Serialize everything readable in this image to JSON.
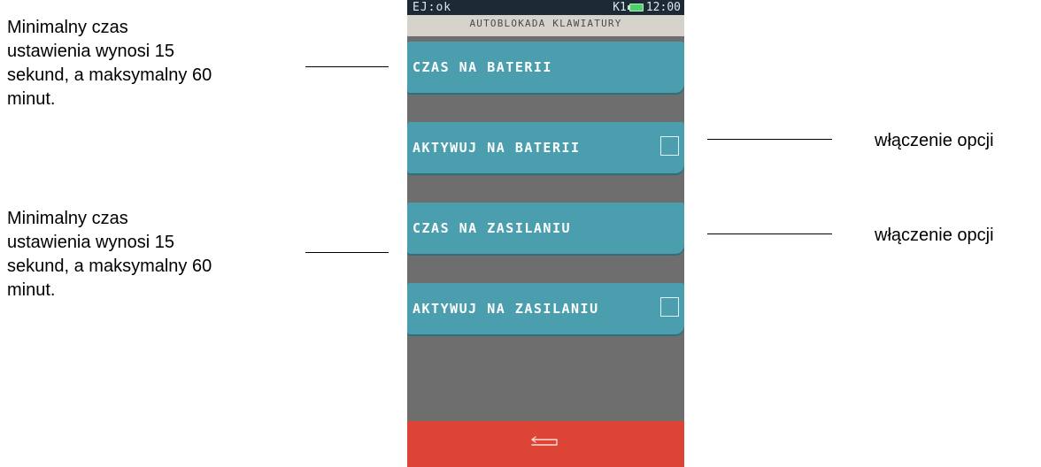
{
  "annotations": {
    "left_top": [
      "Minimalny czas",
      "ustawienia wynosi 15",
      "sekund, a maksymalny 60",
      "minut."
    ],
    "left_bottom": [
      "Minimalny czas",
      "ustawienia wynosi 15",
      "sekund, a maksymalny 60",
      "minut."
    ],
    "right_top": "włączenie opcji",
    "right_bottom": "włączenie opcji"
  },
  "device": {
    "status": {
      "left": "EJ:ok",
      "channel": "K1",
      "time": "12:00"
    },
    "title": "AUTOBLOKADA KLAWIATURY",
    "menu": [
      {
        "label": "CZAS NA BATERII",
        "has_checkbox": false
      },
      {
        "label": "AKTYWUJ NA BATERII",
        "has_checkbox": true,
        "checked": false
      },
      {
        "label": "CZAS NA ZASILANIU",
        "has_checkbox": false
      },
      {
        "label": "AKTYWUJ NA ZASILANIU",
        "has_checkbox": true,
        "checked": false
      }
    ],
    "back_icon": "back-arrow-icon"
  },
  "colors": {
    "menu_button": "#4a9eae",
    "screen_background": "#6e6e6e",
    "title_bar": "#d6d3cd",
    "status_bar": "#1b2a35",
    "back_bar": "#dc4535"
  }
}
